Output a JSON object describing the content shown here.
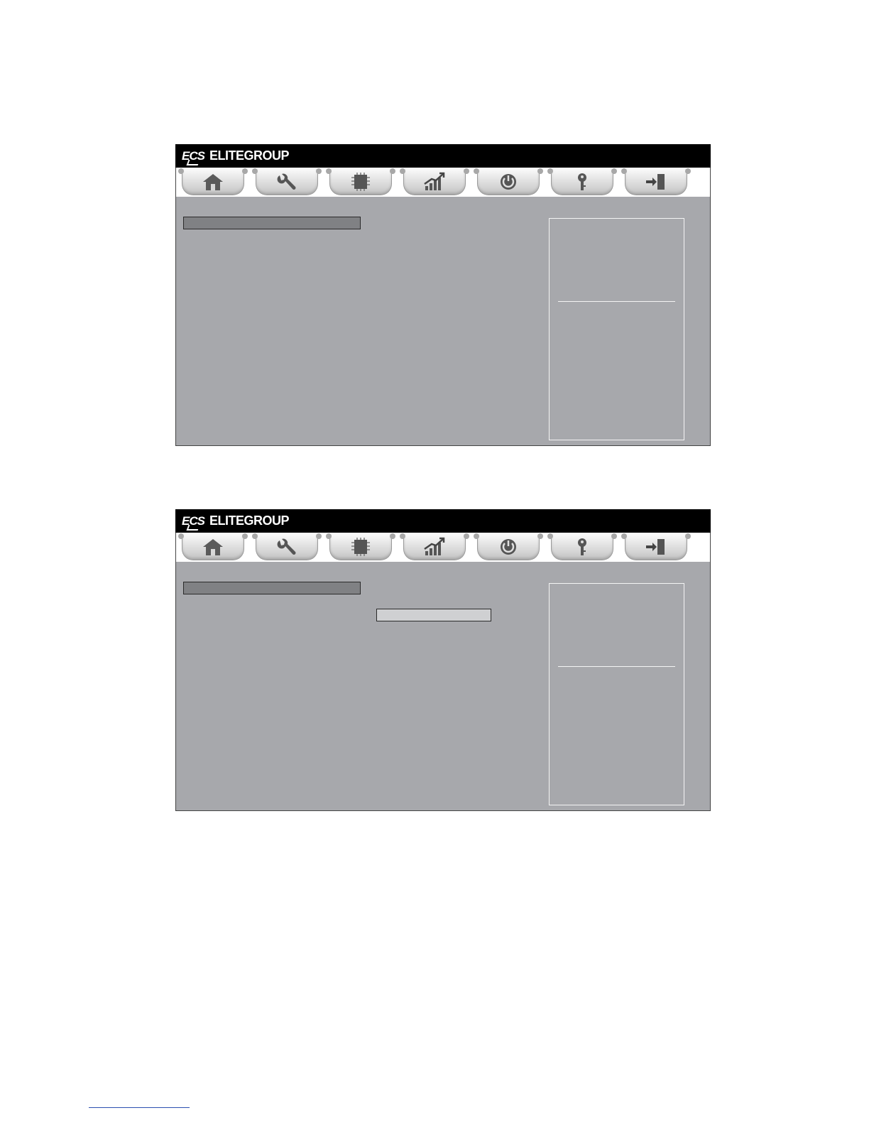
{
  "screens": [
    {
      "brand": {
        "logo": "ECS",
        "name": "ELITEGROUP"
      },
      "tabs": [
        {
          "icon": "home-icon"
        },
        {
          "icon": "wrench-icon"
        },
        {
          "icon": "chip-icon"
        },
        {
          "icon": "chart-icon"
        },
        {
          "icon": "power-icon"
        },
        {
          "icon": "key-icon"
        },
        {
          "icon": "exit-icon"
        }
      ]
    },
    {
      "brand": {
        "logo": "ECS",
        "name": "ELITEGROUP"
      },
      "tabs": [
        {
          "icon": "home-icon"
        },
        {
          "icon": "wrench-icon"
        },
        {
          "icon": "chip-icon"
        },
        {
          "icon": "chart-icon"
        },
        {
          "icon": "power-icon"
        },
        {
          "icon": "key-icon"
        },
        {
          "icon": "exit-icon"
        }
      ]
    }
  ],
  "colors": {
    "panel": "#a7a8ac",
    "titlebar": "#000000",
    "selection": "#808184"
  }
}
